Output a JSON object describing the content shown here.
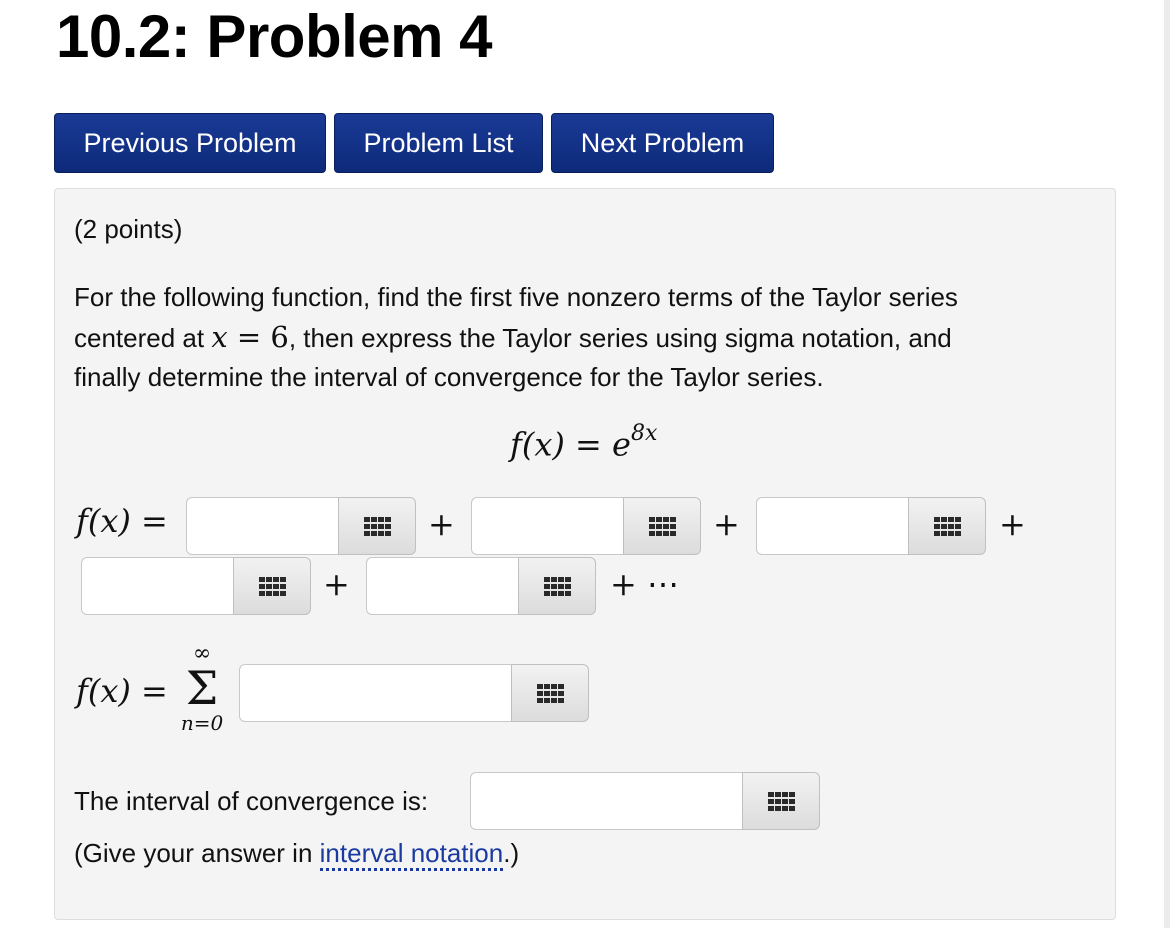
{
  "title": "10.2: Problem 4",
  "nav": {
    "previous": "Previous Problem",
    "list": "Problem List",
    "next": "Next Problem"
  },
  "problem": {
    "points": "(2 points)",
    "statement_line1": "For the following function, find the first five nonzero terms of the Taylor series",
    "statement_line2_pre": "centered at ",
    "statement_line2_x": "x",
    "statement_line2_eq": " = 6",
    "statement_line2_post": ", then express the Taylor series using sigma notation, and",
    "statement_line3": "finally determine the interval of convergence for the Taylor series.",
    "function_lhs": "f(x) = e",
    "function_exponent": "8x",
    "terms_lhs": "f(x) =",
    "plus": "+",
    "tail": "+ ⋯",
    "sigma_lhs": "f(x) =",
    "sigma_upper": "∞",
    "sigma_symbol": "Σ",
    "sigma_lower": "n=0",
    "interval_label": "The interval of convergence is:",
    "hint_pre": "(Give your answer in ",
    "hint_link": "interval notation",
    "hint_post": ".)"
  },
  "icons": {
    "answer_button": "grid-icon"
  },
  "colors": {
    "nav_button": "#0d2a7a",
    "link": "#1a3aa0",
    "panel": "#f4f4f4"
  }
}
